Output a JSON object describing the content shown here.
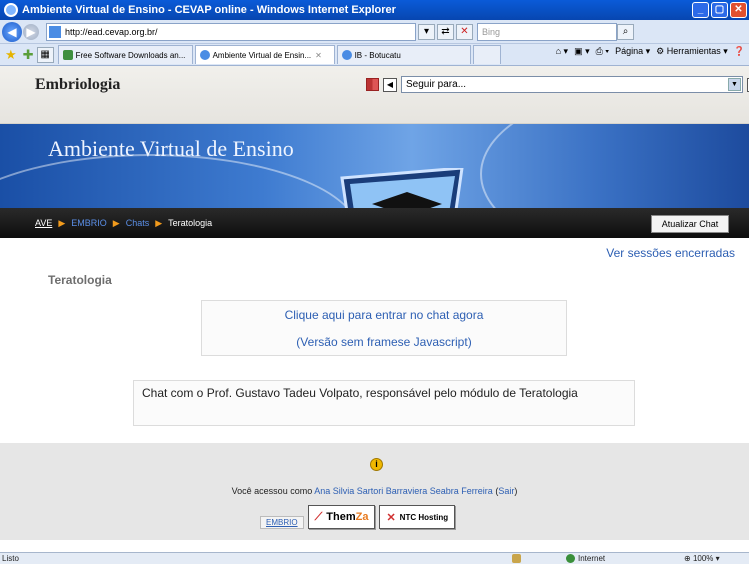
{
  "window": {
    "title": "Ambiente Virtual de Ensino - CEVAP online - Windows Internet Explorer",
    "url": "http://ead.cevap.org.br/",
    "search_placeholder": "Bing"
  },
  "tabs": [
    {
      "label": "Free Software Downloads an..."
    },
    {
      "label": "Ambiente Virtual de Ensin..."
    },
    {
      "label": "IB - Botucatu"
    }
  ],
  "commands": {
    "page": "Página",
    "tools": "Herramientas"
  },
  "header": {
    "course": "Embriologia",
    "jump_placeholder": "Seguir para..."
  },
  "banner": {
    "title": "Ambiente Virtual de Ensino"
  },
  "breadcrumb": {
    "home": "AVE",
    "course": "EMBRIO",
    "chats": "Chats",
    "current": "Teratologia"
  },
  "buttons": {
    "refresh": "Atualizar Chat"
  },
  "links": {
    "sessions": "Ver sessões encerradas",
    "enter_chat": "Clique aqui para entrar no chat agora",
    "no_frames_prefix": "(",
    "no_frames": "Versão sem framese Javascript",
    "no_frames_suffix": ")"
  },
  "chat": {
    "title": "Teratologia",
    "intro": "Chat com o Prof. Gustavo Tadeu Volpato, responsável pelo módulo de Teratologia"
  },
  "footer": {
    "info_icon": "i",
    "logged_prefix": "Você acessou como",
    "user": "Ana Silvia Sartori Barraviera Seabra Ferreira",
    "logout_open": "(",
    "logout": "Sair",
    "logout_close": ")",
    "course_link": "EMBRIO",
    "themza": "Them",
    "themza_accent": "Za",
    "ntc": "NTC Hosting"
  },
  "status": {
    "left": "Listo",
    "zone": "Internet",
    "zoom": "100%"
  }
}
